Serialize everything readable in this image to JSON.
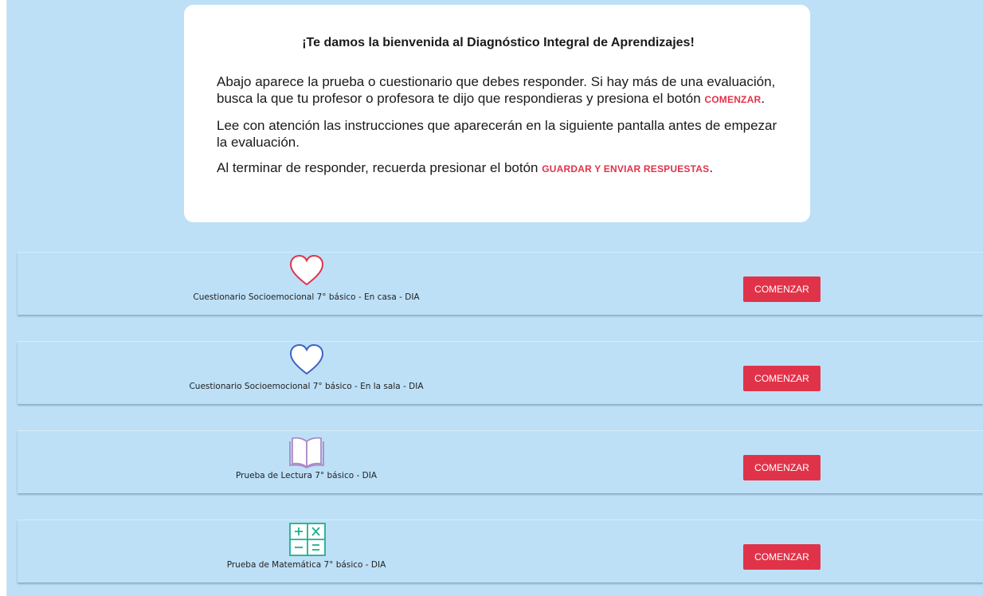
{
  "welcome": {
    "title": "¡Te damos la bienvenida al Diagnóstico Integral de Aprendizajes!",
    "p1_text": "Abajo aparece la prueba o cuestionario que debes responder. Si hay más de una evaluación, busca la que tu profesor o profesora te dijo que respondieras y presiona el botón ",
    "p1_highlight": "COMENZAR",
    "p1_end": ".",
    "p2_text": "Lee con atención las instrucciones que aparecerán en la siguiente pantalla antes de empezar la evaluación.",
    "p3_text": "Al terminar de responder, recuerda presionar el botón ",
    "p3_highlight": "GUARDAR Y ENVIAR RESPUESTAS",
    "p3_end": "."
  },
  "evaluations": [
    {
      "icon": "heart-red-icon",
      "label": "Cuestionario Socioemocional 7° básico - En casa - DIA",
      "button": "COMENZAR"
    },
    {
      "icon": "heart-blue-icon",
      "label": "Cuestionario Socioemocional 7° básico - En la sala - DIA",
      "button": "COMENZAR"
    },
    {
      "icon": "open-book-icon",
      "label": "Prueba de Lectura 7° básico - DIA",
      "button": "COMENZAR"
    },
    {
      "icon": "math-operators-icon",
      "label": "Prueba de Matemática 7° básico - DIA",
      "button": "COMENZAR"
    }
  ],
  "colors": {
    "background": "#bde0f7",
    "accent": "#e0334a",
    "heart_red": "#e0334a",
    "heart_blue": "#3f63c4",
    "book": "#a98bc7",
    "math": "#1fb090"
  }
}
